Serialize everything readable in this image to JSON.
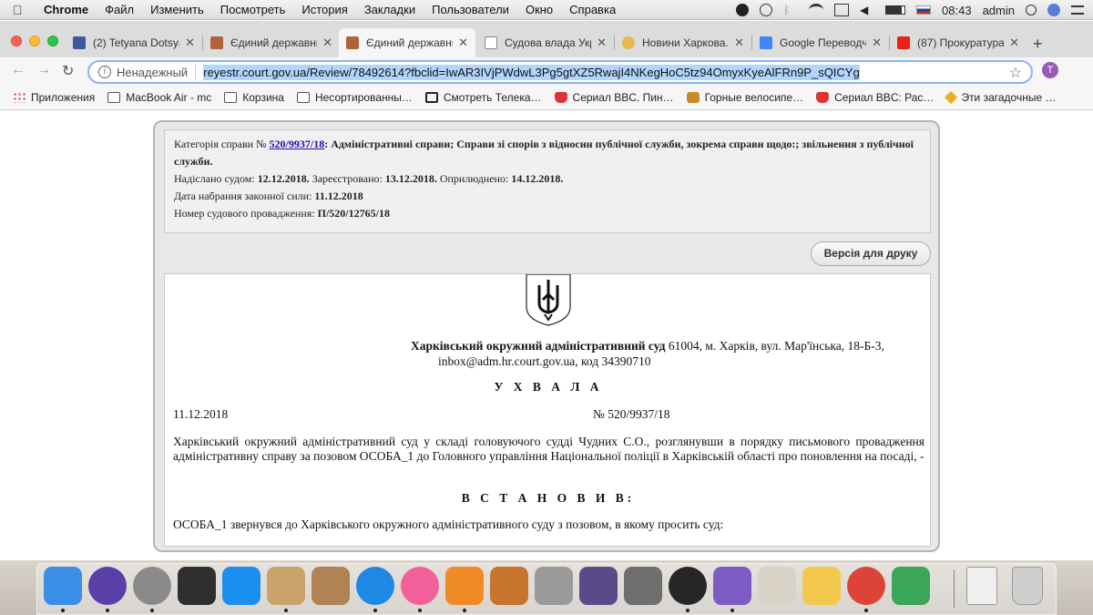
{
  "menubar": {
    "app": "Chrome",
    "items": [
      "Файл",
      "Изменить",
      "Посмотреть",
      "История",
      "Закладки",
      "Пользователи",
      "Окно",
      "Справка"
    ],
    "time": "08:43",
    "user": "admin",
    "icons": [
      "viber-icon",
      "history-icon",
      "bluetooth-icon",
      "wifi-icon",
      "airplay-icon",
      "volume-icon",
      "battery-icon",
      "flag-ru-icon",
      "search-icon",
      "user-avatar-icon",
      "menu-list-icon"
    ]
  },
  "tabs": [
    {
      "title": "(2) Tetyana Dotsya",
      "icon": "facebook-icon",
      "color": "#3b5998"
    },
    {
      "title": "Єдиний державни",
      "icon": "gavel-icon",
      "color": "#b0633a"
    },
    {
      "title": "Єдиний державни",
      "icon": "gavel-icon",
      "color": "#b0633a"
    },
    {
      "title": "Судова влада Укр",
      "icon": "page-icon",
      "color": "#888888"
    },
    {
      "title": "Новини Харкова.",
      "icon": "news-icon",
      "color": "#e8b84a"
    },
    {
      "title": "Google Переводч",
      "icon": "translate-icon",
      "color": "#4285f4"
    },
    {
      "title": "(87) Прокуратура",
      "icon": "youtube-icon",
      "color": "#e62117"
    }
  ],
  "active_tab": 2,
  "toolbar": {
    "security": "Ненадежный",
    "url": "reyestr.court.gov.ua/Review/78492614?fbclid=IwAR3IVjPWdwL3Pg5gtXZ5RwajI4NKegHoC5tz94OmyxKyeAlFRn9P_sQICYg",
    "profile_initial": "T"
  },
  "bookmarks": [
    {
      "label": "Приложения",
      "icon": "apps-grid-icon"
    },
    {
      "label": "MacBook Air - mc",
      "icon": "folder-icon"
    },
    {
      "label": "Корзина",
      "icon": "folder-icon"
    },
    {
      "label": "Несортированны…",
      "icon": "folder-icon"
    },
    {
      "label": "Смотреть Телека…",
      "icon": "tv-icon"
    },
    {
      "label": "Сериал BBC. Пин…",
      "icon": "bbc-icon"
    },
    {
      "label": "Горные велосипе…",
      "icon": "bike-icon"
    },
    {
      "label": "Сериал BBC: Рас…",
      "icon": "bbc-icon"
    },
    {
      "label": "Эти загадочные …",
      "icon": "mystery-icon"
    }
  ],
  "meta": {
    "category_label": "Категорія справи №",
    "case_link": "520/9937/18",
    "category_text": ": Адміністративні справи; Справи зі спорів з відносин публічної служби, зокрема справи щодо:; звільнення з публічної служби.",
    "sent_label": "Надіслано судом:",
    "sent_date": "12.12.2018.",
    "registered_label": "Зареєстровано:",
    "registered_date": "13.12.2018.",
    "published_label": "Оприлюднено:",
    "published_date": "14.12.2018.",
    "effective_label": "Дата набрання законної сили:",
    "effective_date": "11.12.2018",
    "proceeding_label": "Номер судового провадження:",
    "proceeding_number": "П/520/12765/18"
  },
  "print_button": "Версія для друку",
  "document": {
    "court_name": "Харківський окружний адміністративний суд",
    "court_address": "61004, м. Харків, вул. Мар'їнська, 18-Б-3,",
    "court_contacts": "inbox@adm.hr.court.gov.ua, код 34390710",
    "heading": "У Х В А Л А",
    "date": "11.12.2018",
    "number": "№ 520/9937/18",
    "intro": "Харківський окружний адміністративний суд у складі головуючого судді Чудних С.О., розглянувши в порядку письмового провадження адміністративну справу за позовом ОСОБА_1 до Головного управління Національної поліції в Харківській області про поновлення на посаді, -",
    "established": "В С Т А Н О В И В:",
    "body": "ОСОБА_1 звернувся до Харківського окружного адміністративного суду з позовом, в якому просить суд:"
  },
  "dock": {
    "apps": [
      {
        "icon": "finder-icon",
        "color": "#3a8ee6"
      },
      {
        "icon": "siri-icon",
        "color": "#5b3fa8"
      },
      {
        "icon": "launchpad-icon",
        "color": "#8a8a8a"
      },
      {
        "icon": "mission-control-icon",
        "color": "#2f2f2f"
      },
      {
        "icon": "app-store-icon",
        "color": "#1b8ff0"
      },
      {
        "icon": "mail-icon",
        "color": "#c9a36a"
      },
      {
        "icon": "contacts-icon",
        "color": "#b08254"
      },
      {
        "icon": "safari-icon",
        "color": "#1e88e5"
      },
      {
        "icon": "itunes-icon",
        "color": "#f35f9a"
      },
      {
        "icon": "ibooks-icon",
        "color": "#f08a24"
      },
      {
        "icon": "keynote-icon",
        "color": "#c7742e"
      },
      {
        "icon": "no-entry-icon",
        "color": "#9a9a9a"
      },
      {
        "icon": "quill-icon",
        "color": "#5a4a8a"
      },
      {
        "icon": "disk-utility-icon",
        "color": "#6f6f6f"
      },
      {
        "icon": "podcasts-icon",
        "color": "#262626"
      },
      {
        "icon": "viber-icon",
        "color": "#7c5cc4"
      },
      {
        "icon": "preview-icon",
        "color": "#d8d3c6"
      },
      {
        "icon": "photos-icon",
        "color": "#f2c94c"
      },
      {
        "icon": "chrome-icon",
        "color": "#db4437"
      },
      {
        "icon": "numbers-icon",
        "color": "#3aa65a"
      }
    ],
    "files": [
      {
        "icon": "document-icon",
        "color": "#efefef"
      },
      {
        "icon": "trash-icon",
        "color": "#cfcfcf"
      }
    ]
  }
}
